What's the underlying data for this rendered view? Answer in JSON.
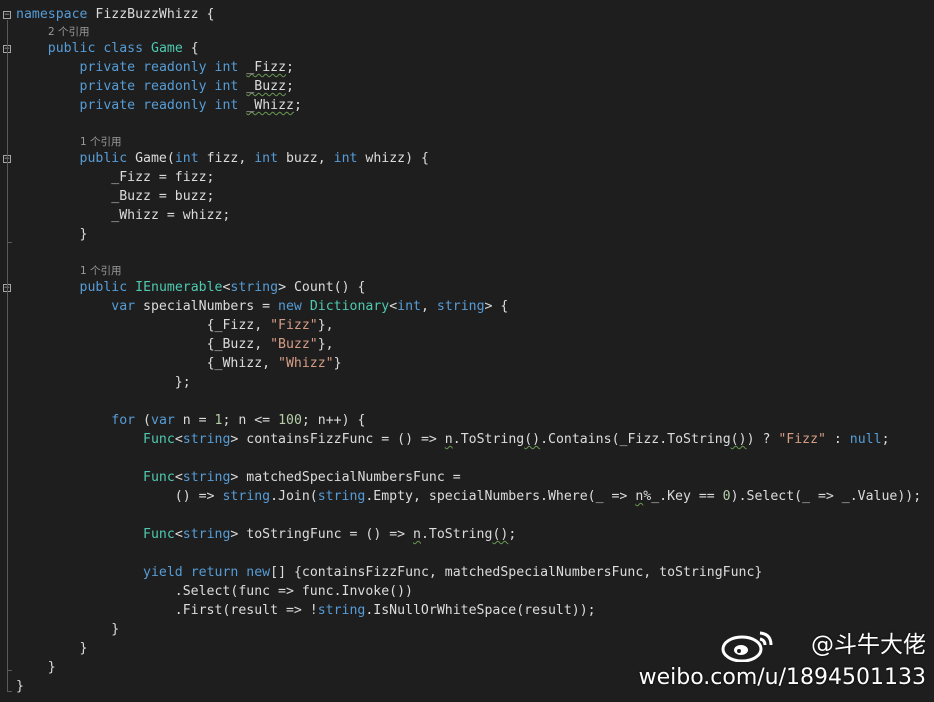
{
  "editor": {
    "code_lens": {
      "refs_2": "2 个引用",
      "refs_1": "1 个引用"
    },
    "tokens": {
      "kw_namespace": "namespace",
      "ns_name": " FizzBuzzWhizz {",
      "kw_public": "public",
      "kw_class": "class",
      "cls_game": "Game",
      "brace_open": " {",
      "kw_private": "private",
      "kw_readonly": "readonly",
      "kw_int": "int",
      "f_fizz": "_Fizz",
      "f_buzz": "_Buzz",
      "f_whizz": "_Whizz",
      "semi": ";",
      "ctor_sig_1": " Game(",
      "ctor_sig_2": " fizz, ",
      "ctor_sig_3": " buzz, ",
      "ctor_sig_4": " whizz) {",
      "assign_fizz": "_Fizz = fizz;",
      "assign_buzz": "_Buzz = buzz;",
      "assign_whizz": "_Whizz = whizz;",
      "brace_close": "}",
      "ty_ienumerable": "IEnumerable",
      "lt": "<",
      "kw_string": "string",
      "gt_count": "> Count() {",
      "kw_var": "var",
      "special_decl": " specialNumbers = ",
      "kw_new": "new",
      "ty_dictionary": "Dictionary",
      "comma_sp": ", ",
      "gt_brace": "> {",
      "entry_fizz_open": "{_Fizz, ",
      "str_fizz": "\"Fizz\"",
      "entry_close_comma": "},",
      "entry_buzz_open": "{_Buzz, ",
      "str_buzz": "\"Buzz\"",
      "entry_whizz_open": "{_Whizz, ",
      "str_whizz": "\"Whizz\"",
      "entry_close": "}",
      "dict_close": "};",
      "kw_for": "for",
      "for_1": " (",
      "for_2": " n = ",
      "num_1": "1",
      "for_3": "; n <= ",
      "num_100": "100",
      "for_4": "; n++) {",
      "ty_func": "Func",
      "gt_sp": ">",
      "contains_decl": " containsFizzFunc = () => ",
      "n": "n",
      "dot_tostring": ".ToString",
      "parens": "()",
      "contains_call": ".Contains(_Fizz.ToString",
      "ternary": ") ? ",
      "colon": " : ",
      "kw_null": "null",
      "matched_decl": " matchedSpecialNumbersFunc =",
      "lambda_open": "() => ",
      "join_1": ".Join(",
      "dot_empty": ".Empty, specialNumbers.Where(_ => ",
      "mod_key": "%_.Key == ",
      "num_0": "0",
      "select_tail": ").Select(_ => _.Value));",
      "tostr_decl": " toStringFunc = () => ",
      "semi_close": ";",
      "kw_yield": "yield",
      "kw_return": "return",
      "yield_tail": "[] {containsFizzFunc, matchedSpecialNumbersFunc, toStringFunc}",
      "select_invoke": ".Select(func => func.Invoke())",
      "first_open": ".First(result => !",
      "isnull_tail": ".IsNullOrWhiteSpace(result));"
    }
  },
  "watermark": {
    "handle": "@斗牛大佬",
    "url": "weibo.com/u/1894501133",
    "logo_icon": "weibo-logo-icon"
  },
  "colors": {
    "background": "#1e1e1e",
    "keyword": "#569cd6",
    "type": "#4ec9b0",
    "string": "#d69d85",
    "number": "#b5cea8",
    "text": "#dcdcdc"
  }
}
